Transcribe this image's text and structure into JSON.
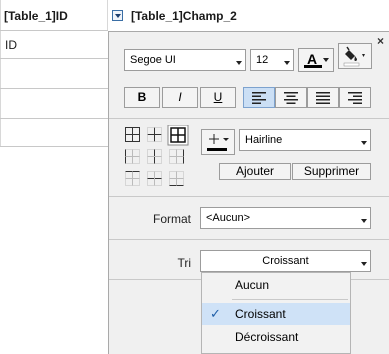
{
  "table": {
    "headers": [
      "[Table_1]ID",
      "[Table_1]Champ_2"
    ],
    "cells": [
      "ID"
    ]
  },
  "panel": {
    "font_family": "Segoe UI",
    "font_size": "12",
    "font_color_label": "A",
    "style_buttons": {
      "bold": "B",
      "italic": "I",
      "underline": "U"
    },
    "border_style": "Hairline",
    "add_label": "Ajouter",
    "delete_label": "Supprimer",
    "format_label": "Format",
    "format_value": "<Aucun>",
    "sort_label": "Tri",
    "sort_value": "Croissant",
    "close_glyph": "×"
  },
  "sort_menu": {
    "options": [
      "Aucun",
      "Croissant",
      "Décroissant"
    ],
    "selected": "Croissant"
  },
  "colors": {
    "font_color_bar": "#000000",
    "fill_color_bar": "#ffffff",
    "selection": "#cfe2f7",
    "align_active": "#cbdff5"
  }
}
